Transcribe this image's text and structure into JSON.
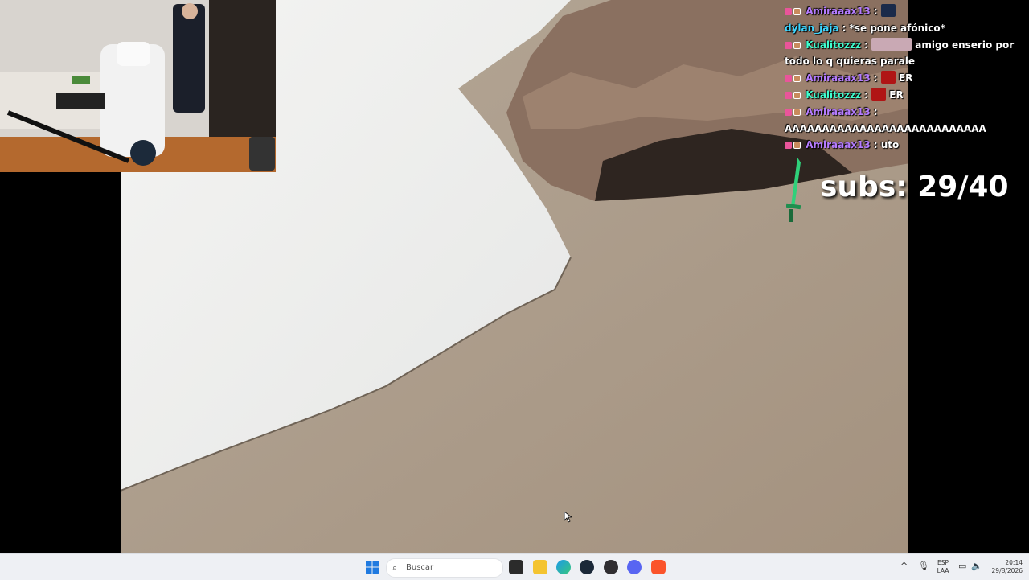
{
  "chat": {
    "messages": [
      {
        "user": "Amiraaax13",
        "text": "",
        "color": "#b57cff",
        "badges": true,
        "emote": "dark-emote"
      },
      {
        "user": "dylan_jaja",
        "text": "*se pone afónico*",
        "color": "#3fd6ff",
        "badges": false
      },
      {
        "user": "Kualitozzz",
        "text": "amigo enserio por todo lo q quieras parale",
        "color": "#3fffd0",
        "badges": true,
        "emote": "face-emote"
      },
      {
        "user": "Amiraaax13",
        "text": "ER",
        "color": "#b57cff",
        "badges": true,
        "emote": "red-emote"
      },
      {
        "user": "Kualitozzz",
        "text": "ER",
        "color": "#3fffd0",
        "badges": true,
        "emote": "red-emote"
      },
      {
        "user": "Amiraaax13",
        "text": "AAAAAAAAAAAAAAAAAAAAAAAAAAA",
        "color": "#b57cff",
        "badges": true
      },
      {
        "user": "Amiraaax13",
        "text": "uto",
        "color": "#b57cff",
        "badges": true
      }
    ]
  },
  "overlay": {
    "subs_label": "subs: 29/40"
  },
  "taskbar": {
    "search_placeholder": "Buscar",
    "language": "ESP",
    "layout": "LAA",
    "time": "20:14",
    "date": "29/8/2026",
    "icons": [
      "windows-start-icon",
      "search-icon",
      "sticky-notes-icon",
      "file-explorer-icon",
      "edge-browser-icon",
      "steam-icon",
      "obs-icon",
      "discord-icon",
      "brave-browser-icon",
      "chevron-up-icon",
      "microphone-icon",
      "display-icon",
      "speaker-icon"
    ]
  },
  "colors": {
    "taskbar_bg": "#eef0f4",
    "chat_purple": "#b57cff",
    "chat_cyan": "#3fd6ff"
  }
}
